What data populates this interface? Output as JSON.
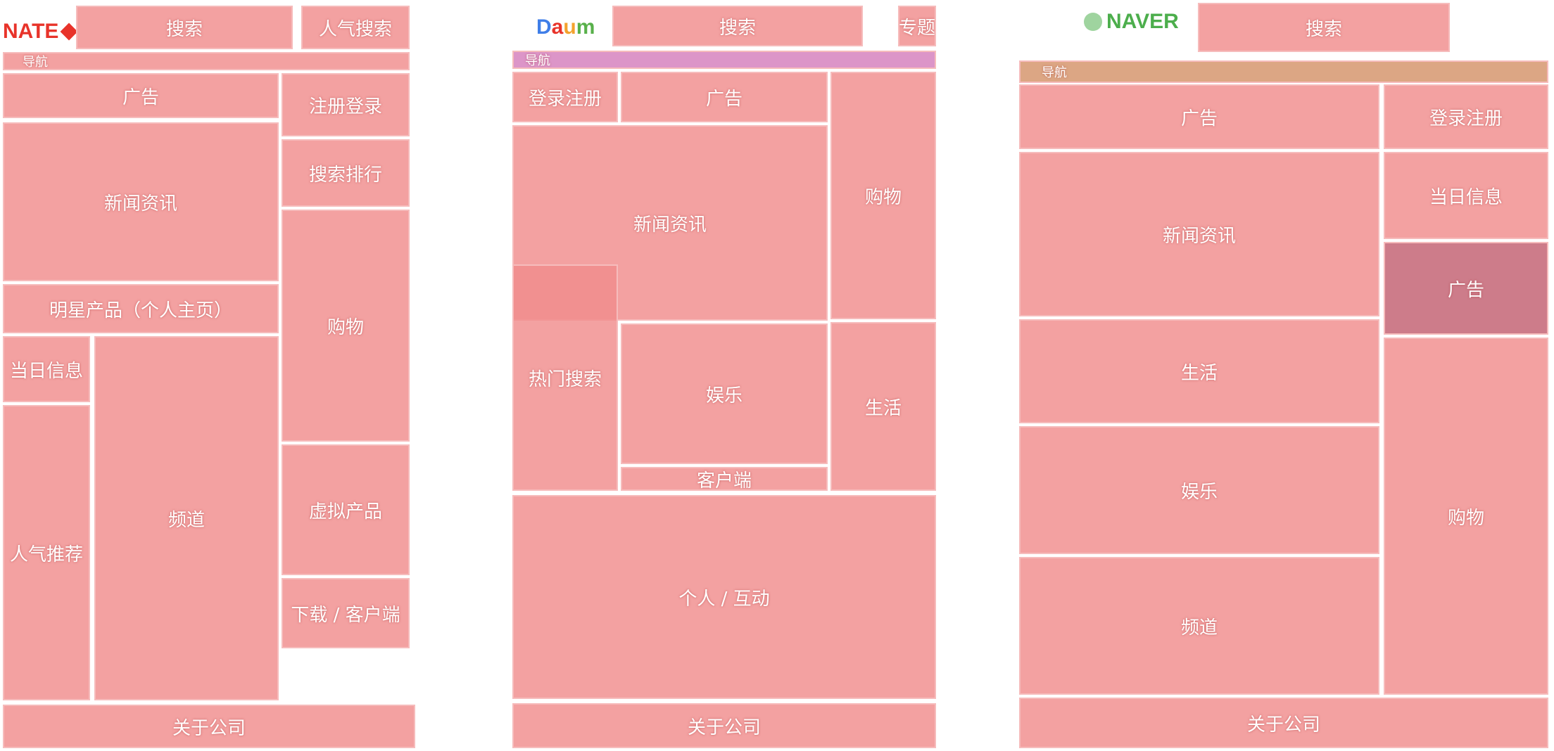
{
  "colors": {
    "overlay": "#f08c8c",
    "nate": "#e8332a",
    "daum_d": "#3f7ee8",
    "daum_a": "#e8332a",
    "daum_u": "#f3a22d",
    "daum_m": "#58b04a",
    "naver": "#4cae4c"
  },
  "logos": {
    "nate": "NATE",
    "daum": "Daum",
    "naver": "NAVER"
  },
  "nate": {
    "search": "搜索",
    "hot_search": "人气搜索",
    "nav": "导航",
    "ad": "广告",
    "login": "注册登录",
    "news": "新闻资讯",
    "ranking": "搜索排行",
    "star": "明星产品（个人主页）",
    "shopping": "购物",
    "today": "当日信息",
    "recommend": "人气推荐",
    "channel": "频道",
    "virtual": "虚拟产品",
    "download": "下载 / 客户端",
    "about": "关于公司"
  },
  "daum": {
    "search": "搜索",
    "topic": "专题",
    "nav": "导航",
    "login": "登录注册",
    "ad": "广告",
    "news": "新闻资讯",
    "shopping": "购物",
    "hot_search": "热门搜索",
    "entertainment": "娱乐",
    "life": "生活",
    "client": "客户端",
    "personal": "个人 / 互动",
    "about": "关于公司"
  },
  "naver": {
    "search": "搜索",
    "nav": "导航",
    "ad": "广告",
    "login": "登录注册",
    "news": "新闻资讯",
    "today": "当日信息",
    "ad2": "广告",
    "life": "生活",
    "entertainment": "娱乐",
    "shopping": "购物",
    "channel": "频道",
    "about": "关于公司"
  }
}
